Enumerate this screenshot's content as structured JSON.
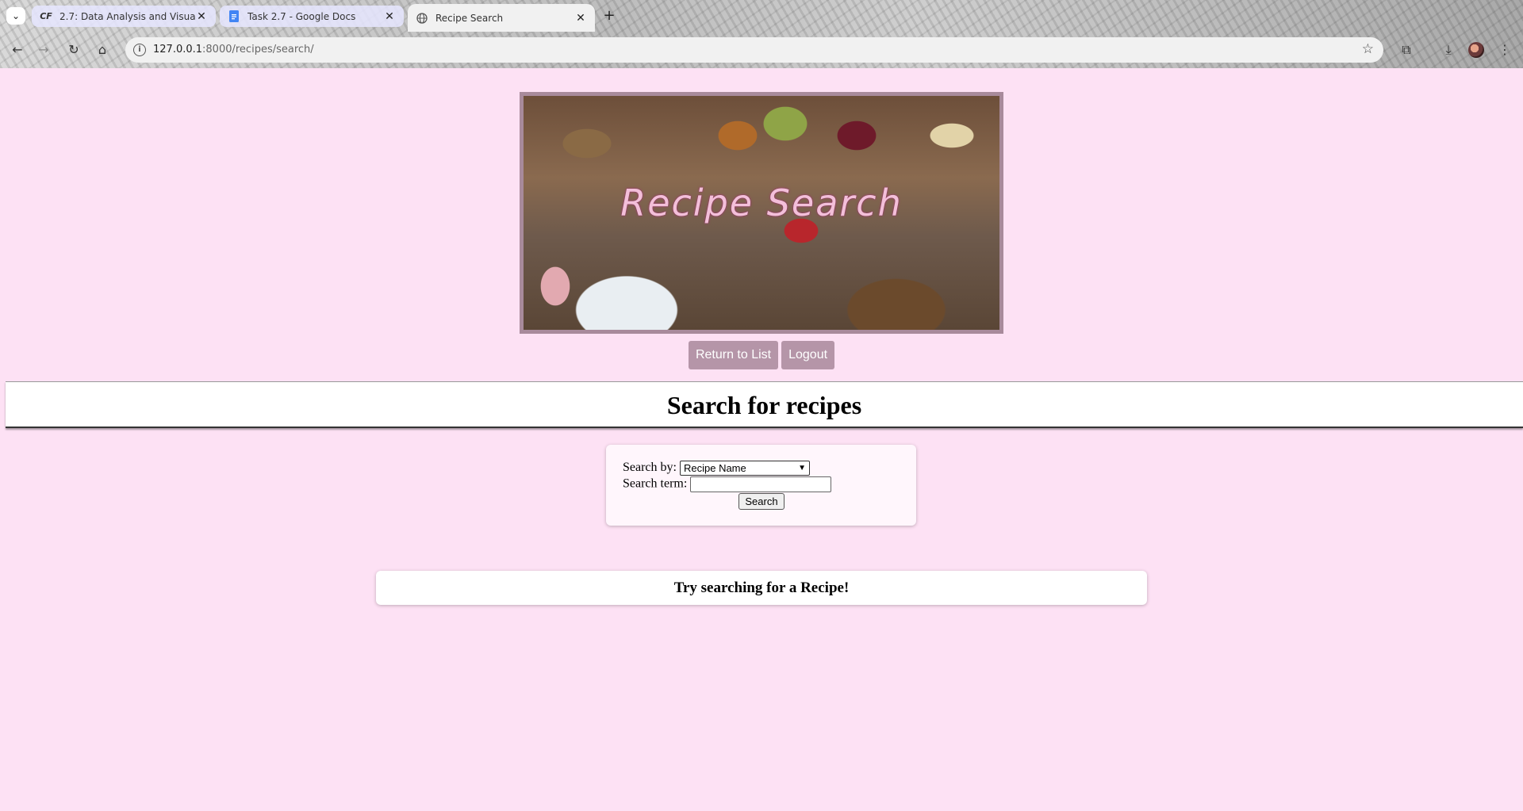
{
  "browser": {
    "tabs": [
      {
        "title": "2.7: Data Analysis and Visualiza",
        "favicon": "CF",
        "state": "inactive"
      },
      {
        "title": "Task 2.7 - Google Docs",
        "favicon": "docs-icon",
        "state": "inactive"
      },
      {
        "title": "Recipe Search",
        "favicon": "globe-icon",
        "state": "active"
      }
    ],
    "close_glyph": "✕",
    "new_tab_glyph": "+",
    "url_host": "127.0.0.1",
    "url_path": ":8000/recipes/search/"
  },
  "banner": {
    "title": "Recipe Search"
  },
  "nav": {
    "return_label": "Return to List",
    "logout_label": "Logout"
  },
  "heading": "Search for recipes",
  "form": {
    "search_by_label": "Search by:",
    "search_by_value": "Recipe Name",
    "search_term_label": "Search term:",
    "search_term_value": "",
    "submit_label": "Search"
  },
  "result_message": "Try searching for a Recipe!",
  "colors": {
    "page_background": "#fde1f4",
    "button_background": "#b595a8",
    "banner_border": "#a88a9b"
  }
}
